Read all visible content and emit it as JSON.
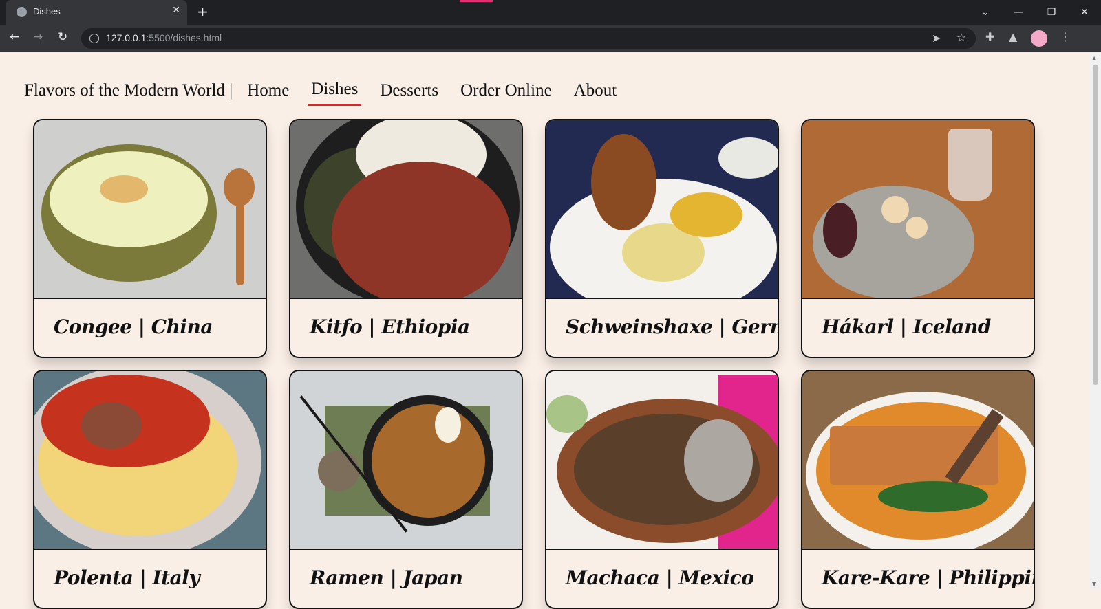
{
  "browser": {
    "tab_title": "Dishes",
    "url_host": "127.0.0.1",
    "url_path": ":5500/dishes.html"
  },
  "site": {
    "brand": "Flavors of the Modern World |",
    "nav": [
      "Home",
      "Dishes",
      "Desserts",
      "Order Online",
      "About"
    ],
    "active_nav": "Dishes"
  },
  "dishes": [
    {
      "title": "Congee | China"
    },
    {
      "title": "Kitfo | Ethiopia"
    },
    {
      "title": "Schweinshaxe | Germany"
    },
    {
      "title": "Hákarl | Iceland"
    },
    {
      "title": "Polenta | Italy"
    },
    {
      "title": "Ramen | Japan"
    },
    {
      "title": "Machaca | Mexico"
    },
    {
      "title": "Kare-Kare | Philippines"
    }
  ],
  "colors": {
    "page_background": "#faefe7",
    "active_underline": "#e02424",
    "card_border": "#111111"
  }
}
